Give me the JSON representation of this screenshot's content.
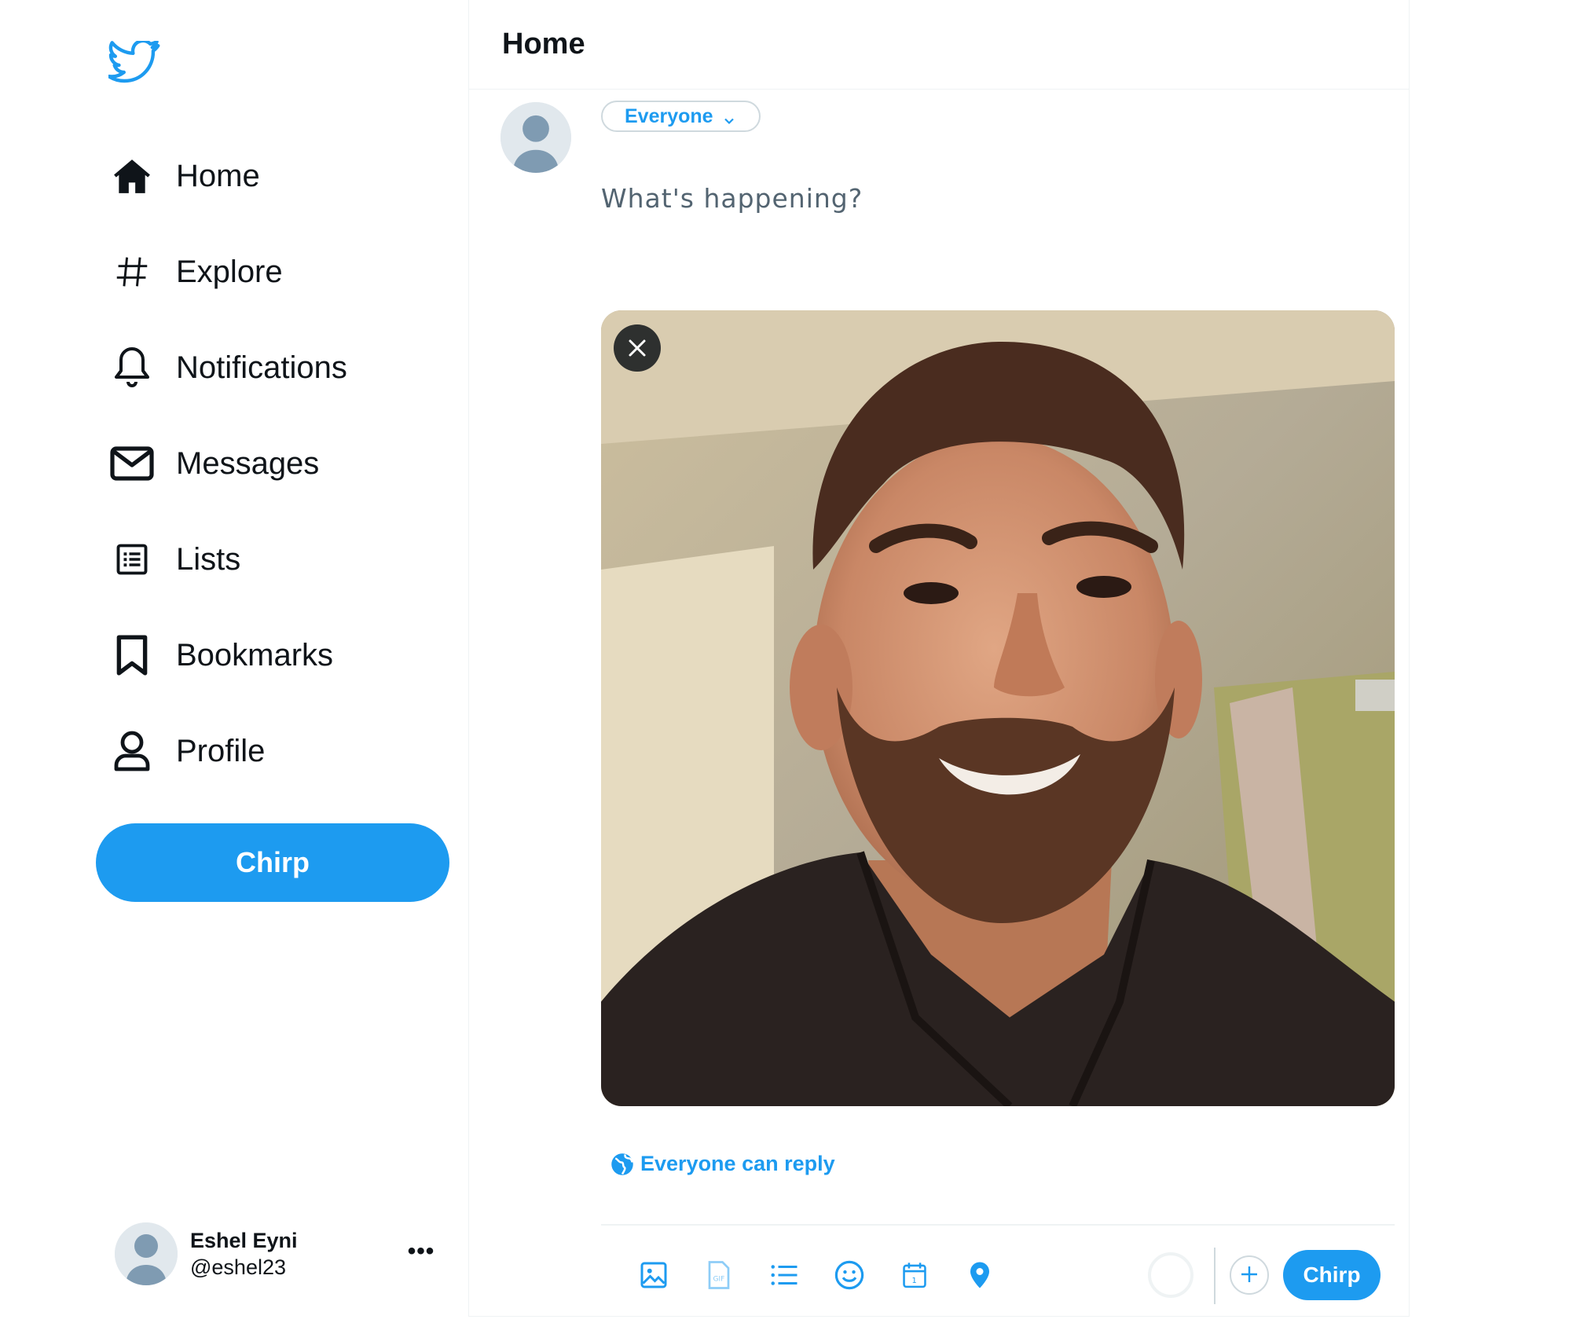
{
  "sidebar": {
    "logo": "bird-icon",
    "nav": [
      {
        "label": "Home",
        "icon": "home-icon"
      },
      {
        "label": "Explore",
        "icon": "hashtag-icon"
      },
      {
        "label": "Notifications",
        "icon": "bell-icon"
      },
      {
        "label": "Messages",
        "icon": "envelope-icon"
      },
      {
        "label": "Lists",
        "icon": "list-icon"
      },
      {
        "label": "Bookmarks",
        "icon": "bookmark-icon"
      },
      {
        "label": "Profile",
        "icon": "profile-icon"
      }
    ],
    "chirp_button": "Chirp",
    "account": {
      "display_name": "Eshel Eyni",
      "handle": "@eshel23",
      "more": "•••"
    }
  },
  "main": {
    "title": "Home",
    "composer": {
      "audience": "Everyone",
      "placeholder": "What's happening?",
      "reply_setting": "Everyone can reply",
      "toolbar_icons": [
        "image-icon",
        "gif-icon",
        "poll-icon",
        "emoji-icon",
        "schedule-icon",
        "location-icon"
      ],
      "submit_label": "Chirp"
    }
  },
  "colors": {
    "accent": "#1d9bf0",
    "text": "#0f1419",
    "muted": "#536471",
    "border": "#eff3f4"
  }
}
